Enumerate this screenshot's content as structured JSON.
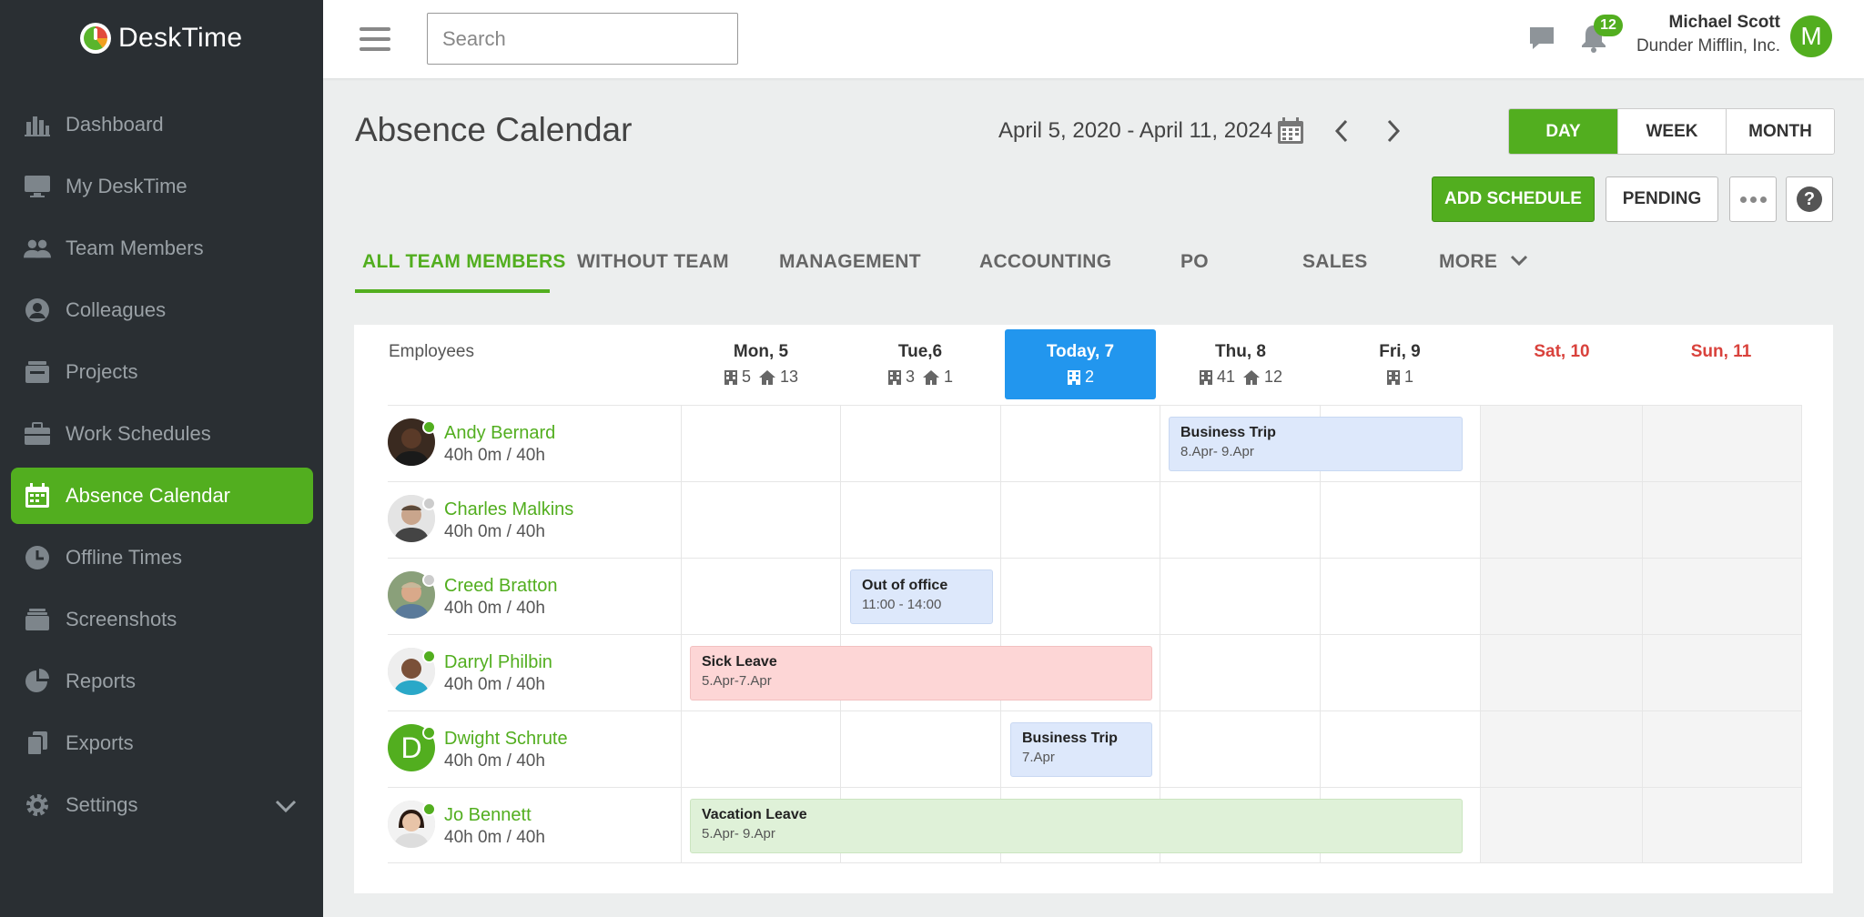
{
  "brand": {
    "name": "DeskTime"
  },
  "sidebar": {
    "items": [
      {
        "label": "Dashboard",
        "icon": "bar-chart-icon"
      },
      {
        "label": "My DeskTime",
        "icon": "monitor-icon"
      },
      {
        "label": "Team Members",
        "icon": "team-icon"
      },
      {
        "label": "Colleagues",
        "icon": "user-circle-icon"
      },
      {
        "label": "Projects",
        "icon": "projects-icon"
      },
      {
        "label": "Work Schedules",
        "icon": "briefcase-icon"
      },
      {
        "label": "Absence Calendar",
        "icon": "calendar-icon",
        "active": true
      },
      {
        "label": "Offline Times",
        "icon": "clock-icon"
      },
      {
        "label": "Screenshots",
        "icon": "screenshots-icon"
      },
      {
        "label": "Reports",
        "icon": "pie-chart-icon"
      },
      {
        "label": "Exports",
        "icon": "exports-icon"
      },
      {
        "label": "Settings",
        "icon": "gear-icon"
      }
    ]
  },
  "header": {
    "search_placeholder": "Search",
    "notifications_count": "12",
    "user_name": "Michael Scott",
    "user_company": "Dunder Mifflin, Inc.",
    "user_initial": "M"
  },
  "page": {
    "title": "Absence Calendar",
    "date_range": "April 5, 2020 - April 11, 2024",
    "views": [
      "DAY",
      "WEEK",
      "MONTH"
    ],
    "active_view": "DAY",
    "add_schedule": "ADD SCHEDULE",
    "pending": "PENDING",
    "help": "?"
  },
  "tabs": [
    "ALL TEAM MEMBERS",
    "WITHOUT TEAM",
    "MANAGEMENT",
    "ACCOUNTING",
    "PO",
    "SALES",
    "MORE"
  ],
  "calendar": {
    "employees_header": "Employees",
    "days": [
      {
        "label": "Mon, 5",
        "office": "5",
        "home": "13"
      },
      {
        "label": "Tue,6",
        "office": "3",
        "home": "1"
      },
      {
        "label": "Today, 7",
        "office": "2",
        "home": "",
        "today": true
      },
      {
        "label": "Thu, 8",
        "office": "41",
        "home": "12"
      },
      {
        "label": "Fri, 9",
        "office": "1",
        "home": ""
      },
      {
        "label": "Sat, 10",
        "office": "",
        "home": "",
        "weekend": true
      },
      {
        "label": "Sun, 11",
        "office": "",
        "home": "",
        "weekend": true
      }
    ],
    "employees": [
      {
        "name": "Andy Bernard",
        "hours": "40h 0m / 40h",
        "status_color": "#52ae1f"
      },
      {
        "name": "Charles Malkins",
        "hours": "40h 0m / 40h",
        "status_color": "#cccccc"
      },
      {
        "name": "Creed Bratton",
        "hours": "40h 0m / 40h",
        "status_color": "#cccccc"
      },
      {
        "name": "Darryl Philbin",
        "hours": "40h 0m / 40h",
        "status_color": "#52ae1f"
      },
      {
        "name": "Dwight Schrute",
        "hours": "40h 0m / 40h",
        "status_color": "#52ae1f",
        "initial": "D"
      },
      {
        "name": "Jo Bennett",
        "hours": "40h 0m / 40h",
        "status_color": "#52ae1f"
      }
    ],
    "events": [
      {
        "title": "Business Trip",
        "range": "8.Apr- 9.Apr",
        "color": "blue"
      },
      {
        "title": "Out of office",
        "range": "11:00 - 14:00",
        "color": "blue"
      },
      {
        "title": "Sick Leave",
        "range": "5.Apr-7.Apr",
        "color": "red"
      },
      {
        "title": "Business Trip",
        "range": "7.Apr",
        "color": "blue"
      },
      {
        "title": "Vacation Leave",
        "range": "5.Apr- 9.Apr",
        "color": "green"
      }
    ]
  },
  "colors": {
    "accent": "#52ae1f",
    "today": "#2296ee",
    "sidebar": "#2a2f33",
    "weekend_text": "#d9423c"
  }
}
